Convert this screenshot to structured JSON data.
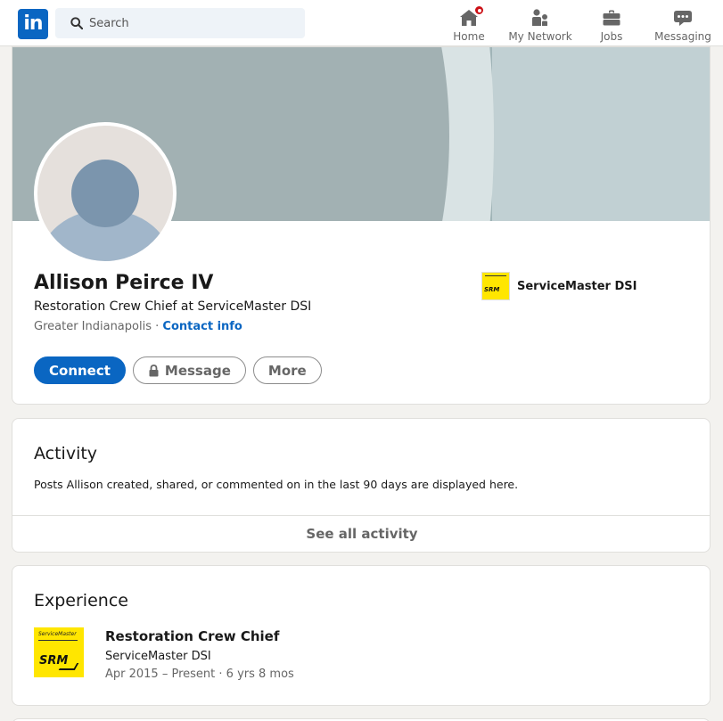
{
  "nav": {
    "logo_text": "in",
    "search_placeholder": "Search",
    "items": [
      {
        "label": "Home",
        "icon": "home-icon",
        "has_badge": true
      },
      {
        "label": "My Network",
        "icon": "people-icon"
      },
      {
        "label": "Jobs",
        "icon": "briefcase-icon"
      },
      {
        "label": "Messaging",
        "icon": "chat-bubble-icon"
      }
    ]
  },
  "profile": {
    "name": "Allison Peirce IV",
    "headline": "Restoration Crew Chief at ServiceMaster DSI",
    "location": "Greater Indianapolis",
    "separator": "·",
    "contact_label": "Contact info",
    "current_company": "ServiceMaster DSI",
    "actions": {
      "connect": "Connect",
      "message": "Message",
      "more": "More"
    }
  },
  "activity": {
    "title": "Activity",
    "description": "Posts Allison created, shared, or commented on in the last 90 days are displayed here.",
    "see_all": "See all activity"
  },
  "experience": {
    "title": "Experience",
    "items": [
      {
        "role": "Restoration Crew Chief",
        "company": "ServiceMaster DSI",
        "dates": "Apr 2015 – Present",
        "separator": "·",
        "duration": "6 yrs 8 mos"
      }
    ]
  },
  "colors": {
    "brand": "#0a66c2",
    "badge": "#cc1016",
    "company_logo": "#ffe600"
  }
}
